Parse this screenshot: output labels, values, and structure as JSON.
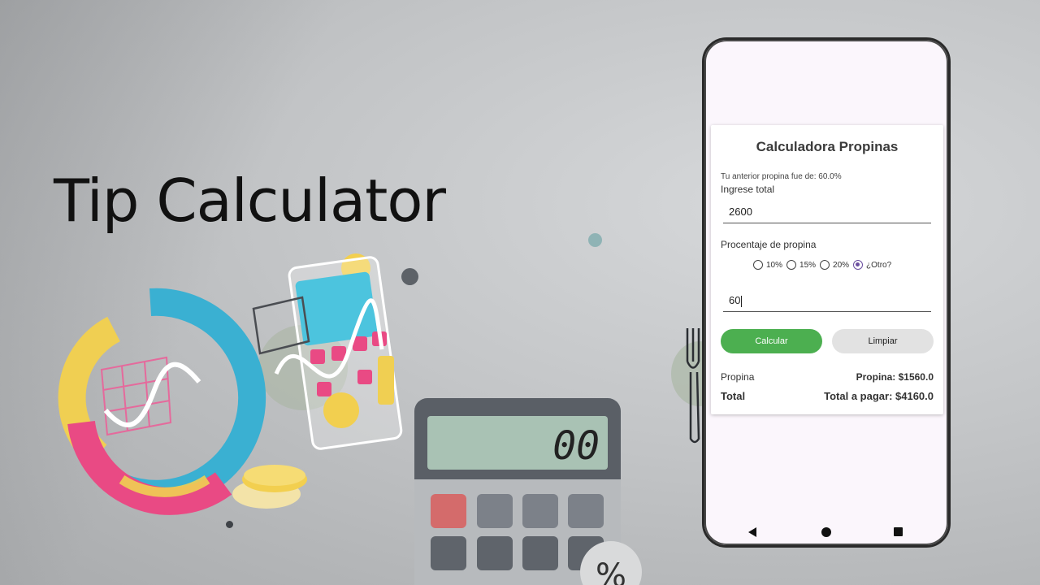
{
  "hero": {
    "title": "Tip Calculator"
  },
  "calculator_display": "00",
  "calculator_percent": "%",
  "app": {
    "title": "Calculadora Propinas",
    "previous_tip": "Tu anterior propina fue de: 60.0%",
    "total_label": "Ingrese total",
    "total_value": "2600",
    "percent_label": "Procentaje de propina",
    "options": [
      {
        "label": "10%",
        "selected": false
      },
      {
        "label": "15%",
        "selected": false
      },
      {
        "label": "20%",
        "selected": false
      },
      {
        "label": "¿Otro?",
        "selected": true
      }
    ],
    "custom_value": "60",
    "calc_button": "Calcular",
    "clear_button": "Limpiar",
    "tip_label": "Propina",
    "tip_result": "Propina: $1560.0",
    "total_result_label": "Total",
    "total_result": "Total a pagar: $4160.0"
  },
  "colors": {
    "accent_green": "#4caf50",
    "radio_selected": "#6b4ea0",
    "phone_background": "#fbf6fc"
  },
  "icons": [
    "back-nav-icon",
    "home-nav-icon",
    "recents-nav-icon",
    "fork-icon"
  ]
}
